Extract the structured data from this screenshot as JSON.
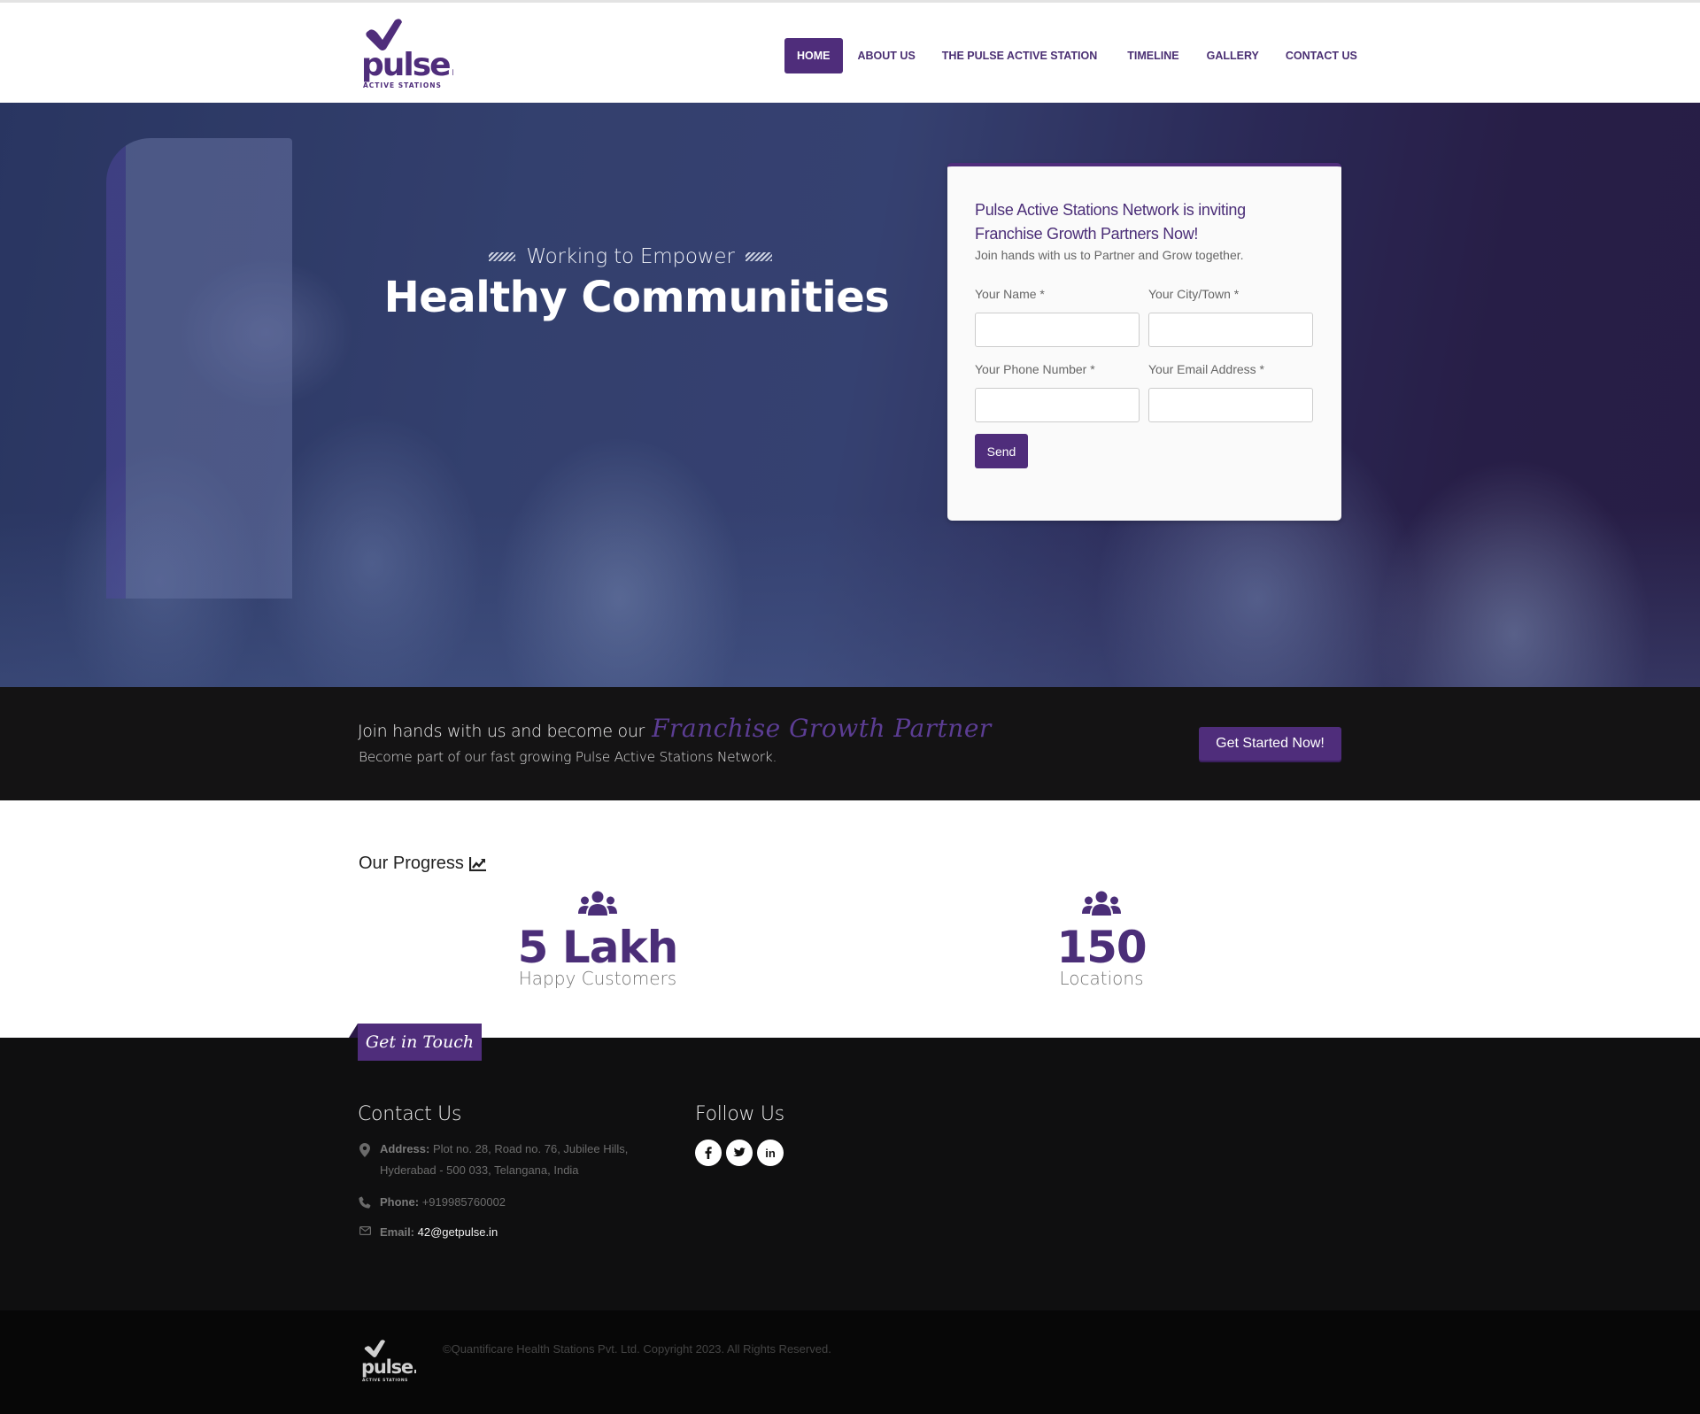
{
  "brand": {
    "name": "pulse.",
    "tagline": "ACTIVE STATIONS",
    "primary_color": "#4f2d7b",
    "script_color": "#5c3d94"
  },
  "nav": {
    "items": [
      {
        "label": "HOME",
        "active": true
      },
      {
        "label": "ABOUT US",
        "active": false
      },
      {
        "label": "THE PULSE ACTIVE STATION",
        "active": false
      },
      {
        "label": "TIMELINE",
        "active": false
      },
      {
        "label": "GALLERY",
        "active": false
      },
      {
        "label": "CONTACT US",
        "active": false
      }
    ]
  },
  "hero": {
    "subtitle": "Working to Empower",
    "title": "Healthy Communities"
  },
  "form": {
    "title": "Pulse Active Stations Network is inviting Franchise Growth Partners Now!",
    "description": "Join hands with us to Partner and Grow together.",
    "fields": [
      {
        "label": "Your Name *",
        "value": ""
      },
      {
        "label": "Your City/Town *",
        "value": ""
      },
      {
        "label": "Your Phone Number *",
        "value": ""
      },
      {
        "label": "Your Email Address *",
        "value": ""
      }
    ],
    "submit_label": "Send"
  },
  "cta": {
    "lead": "Join hands with us and become our",
    "highlight": "Franchise Growth Partner",
    "sub": "Become part of our fast growing Pulse Active Stations Network.",
    "button_label": "Get Started Now!"
  },
  "progress": {
    "title": "Our Progress",
    "stats": [
      {
        "icon": "users-icon",
        "value": "5 Lakh",
        "label": "Happy Customers"
      },
      {
        "icon": "users-icon",
        "value": "150",
        "label": "Locations"
      }
    ]
  },
  "footer": {
    "tab_label": "Get in Touch",
    "contact_heading": "Contact Us",
    "address_label": "Address:",
    "address_line1": "Plot no. 28, Road no. 76, Jubilee Hills,",
    "address_line2": "Hyderabad - 500 033, Telangana, India",
    "phone_label": "Phone:",
    "phone": "+919985760002",
    "email_label": "Email:",
    "email": "42@getpulse.in",
    "follow_heading": "Follow Us",
    "social": [
      {
        "name": "facebook",
        "glyph": "f"
      },
      {
        "name": "twitter",
        "glyph": "t"
      },
      {
        "name": "linkedin",
        "glyph": "in"
      }
    ],
    "copyright": "©Quantificare Health Stations Pvt. Ltd. Copyright 2023. All Rights Reserved."
  }
}
